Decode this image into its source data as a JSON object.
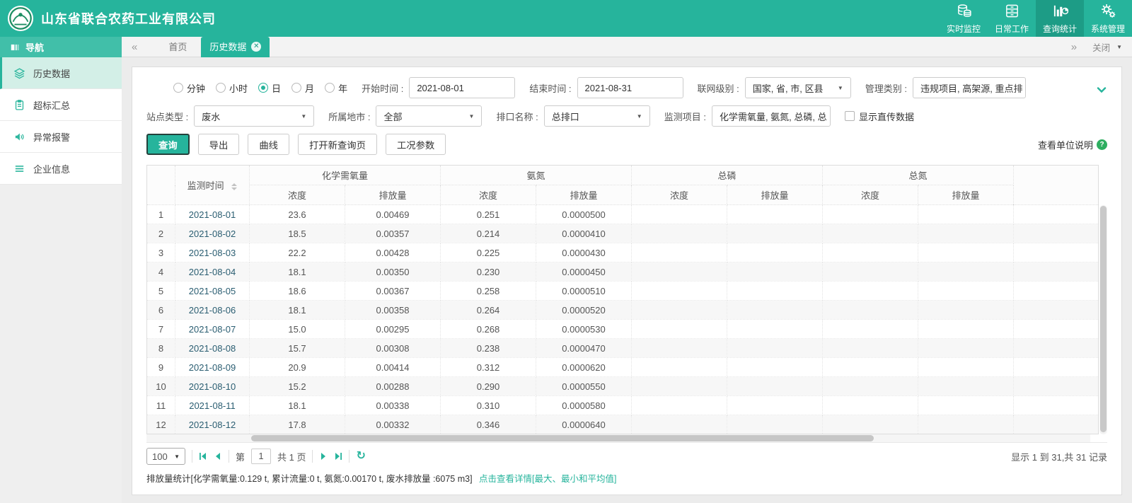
{
  "header": {
    "company": "山东省联合农药工业有限公司",
    "nav": [
      {
        "label": "实时监控",
        "icon": "database-icon",
        "active": false
      },
      {
        "label": "日常工作",
        "icon": "archive-icon",
        "active": false
      },
      {
        "label": "查询统计",
        "icon": "barchart-icon",
        "active": true
      },
      {
        "label": "系统管理",
        "icon": "gears-icon",
        "active": false
      }
    ]
  },
  "sidebar": {
    "title": "导航",
    "items": [
      {
        "label": "历史数据",
        "icon": "layers-icon",
        "active": true
      },
      {
        "label": "超标汇总",
        "icon": "clipboard-icon",
        "active": false
      },
      {
        "label": "异常报警",
        "icon": "speaker-icon",
        "active": false
      },
      {
        "label": "企业信息",
        "icon": "list-icon",
        "active": false
      }
    ]
  },
  "tabs": {
    "home": "首页",
    "current": "历史数据",
    "close_menu": "关闭"
  },
  "filters": {
    "periods": [
      "分钟",
      "小时",
      "日",
      "月",
      "年"
    ],
    "period_selected": "日",
    "start_label": "开始时间 :",
    "start_value": "2021-08-01",
    "end_label": "结束时间 :",
    "end_value": "2021-08-31",
    "network_label": "联网级别 :",
    "network_value": "国家, 省, 市, 区县",
    "manage_label": "管理类别 :",
    "manage_value": "违规项目, 高架源, 重点排",
    "station_label": "站点类型 :",
    "station_value": "废水",
    "city_label": "所属地市 :",
    "city_value": "全部",
    "outlet_label": "排口名称 :",
    "outlet_value": "总排口",
    "monitor_label": "监测项目 :",
    "monitor_value": "化学需氧量, 氨氮, 总磷, 总",
    "direct_checkbox": "显示直传数据"
  },
  "toolbar": {
    "query": "查询",
    "export": "导出",
    "curve": "曲线",
    "new_query": "打开新查询页",
    "condition": "工况参数",
    "unit_help": "查看单位说明"
  },
  "table": {
    "time_header": "监测时间",
    "groups": [
      "化学需氧量",
      "氨氮",
      "总磷",
      "总氮"
    ],
    "sub_conc": "浓度",
    "sub_emis": "排放量",
    "rows": [
      [
        "1",
        "2021-08-01",
        "23.6",
        "0.00469",
        "0.251",
        "0.0000500",
        "",
        "",
        "",
        ""
      ],
      [
        "2",
        "2021-08-02",
        "18.5",
        "0.00357",
        "0.214",
        "0.0000410",
        "",
        "",
        "",
        ""
      ],
      [
        "3",
        "2021-08-03",
        "22.2",
        "0.00428",
        "0.225",
        "0.0000430",
        "",
        "",
        "",
        ""
      ],
      [
        "4",
        "2021-08-04",
        "18.1",
        "0.00350",
        "0.230",
        "0.0000450",
        "",
        "",
        "",
        ""
      ],
      [
        "5",
        "2021-08-05",
        "18.6",
        "0.00367",
        "0.258",
        "0.0000510",
        "",
        "",
        "",
        ""
      ],
      [
        "6",
        "2021-08-06",
        "18.1",
        "0.00358",
        "0.264",
        "0.0000520",
        "",
        "",
        "",
        ""
      ],
      [
        "7",
        "2021-08-07",
        "15.0",
        "0.00295",
        "0.268",
        "0.0000530",
        "",
        "",
        "",
        ""
      ],
      [
        "8",
        "2021-08-08",
        "15.7",
        "0.00308",
        "0.238",
        "0.0000470",
        "",
        "",
        "",
        ""
      ],
      [
        "9",
        "2021-08-09",
        "20.9",
        "0.00414",
        "0.312",
        "0.0000620",
        "",
        "",
        "",
        ""
      ],
      [
        "10",
        "2021-08-10",
        "15.2",
        "0.00288",
        "0.290",
        "0.0000550",
        "",
        "",
        "",
        ""
      ],
      [
        "11",
        "2021-08-11",
        "18.1",
        "0.00338",
        "0.310",
        "0.0000580",
        "",
        "",
        "",
        ""
      ],
      [
        "12",
        "2021-08-12",
        "17.8",
        "0.00332",
        "0.346",
        "0.0000640",
        "",
        "",
        "",
        ""
      ]
    ]
  },
  "pagination": {
    "page_size": "100",
    "prefix": "第",
    "page": "1",
    "suffix": "共 1 页",
    "summary": "显示 1 到 31,共 31 记录"
  },
  "footer": {
    "stats": "排放量统计[化学需氧量:0.129 t, 累计流量:0 t, 氨氮:0.00170 t, 废水排放量 :6075 m3]",
    "detail_link": "点击查看详情[最大、最小和平均值]"
  }
}
